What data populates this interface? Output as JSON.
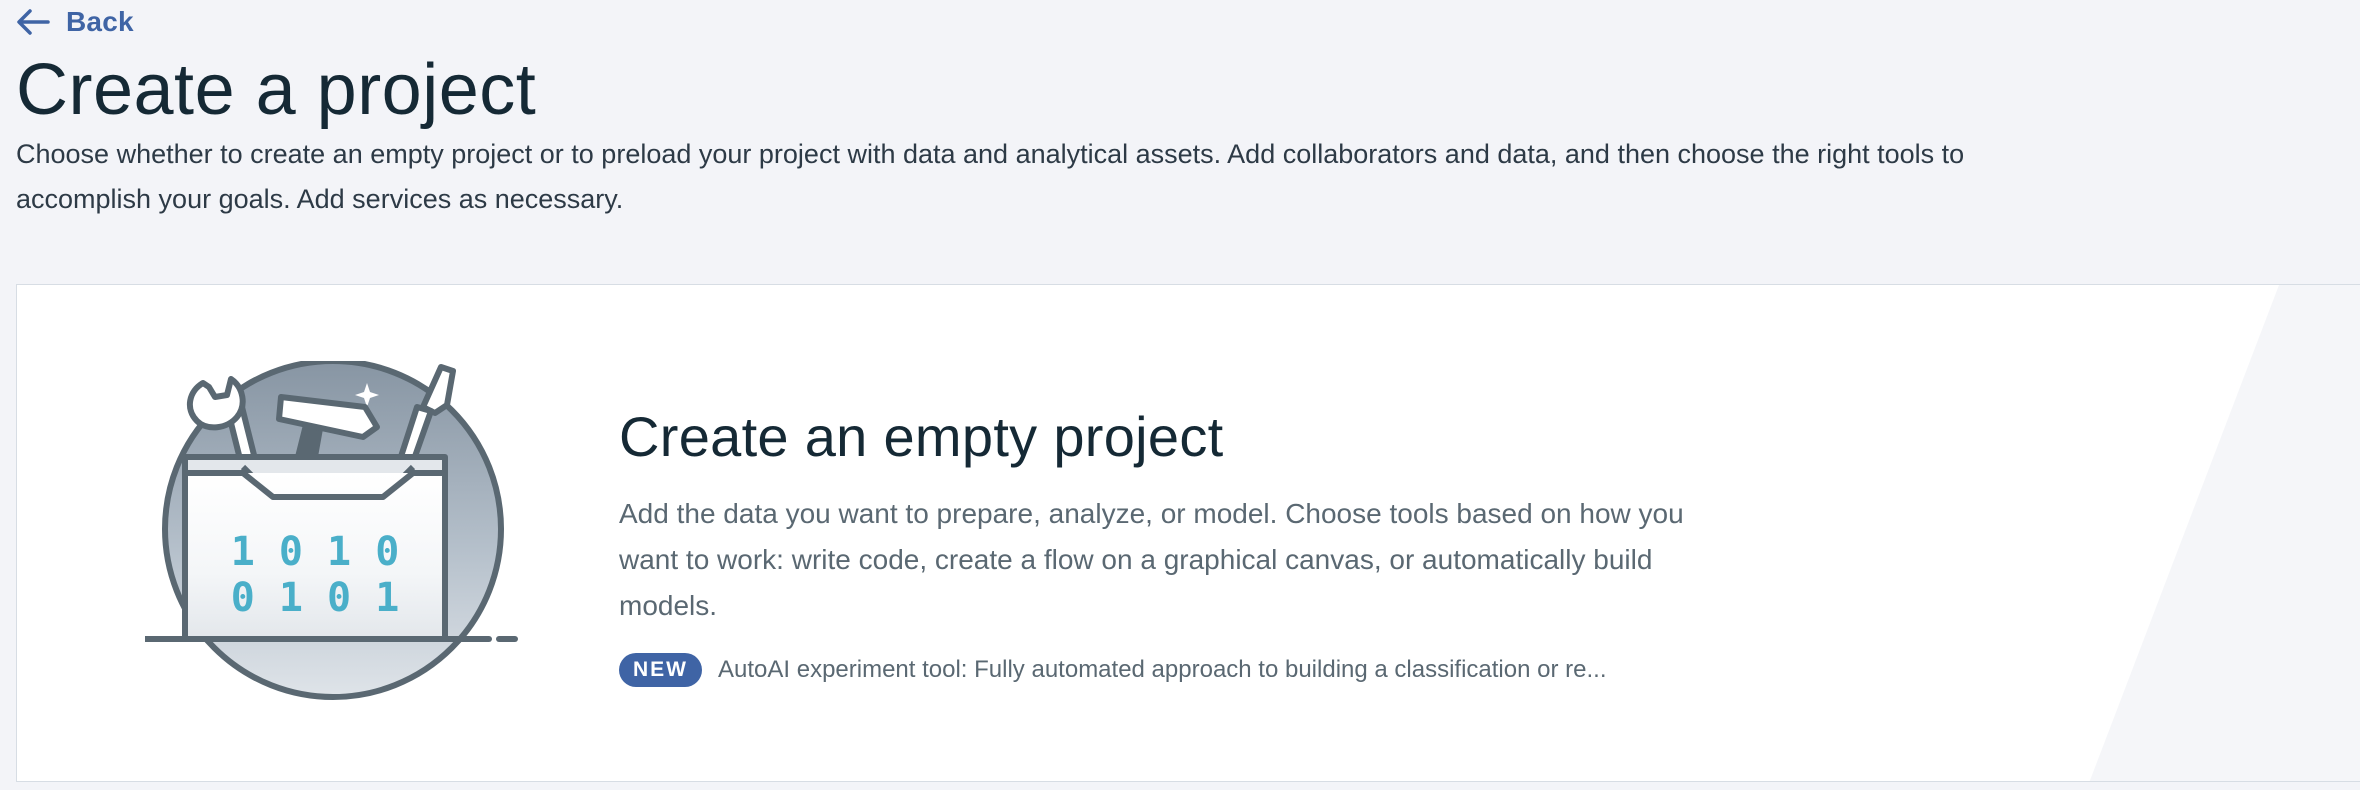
{
  "nav": {
    "back_label": "Back"
  },
  "header": {
    "title": "Create a project",
    "description": "Choose whether to create an empty project or to preload your project with data and analytical assets. Add collaborators and data, and then choose the right tools to accomplish your goals. Add services as necessary."
  },
  "card": {
    "title": "Create an empty project",
    "description": "Add the data you want to prepare, analyze, or model. Choose tools based on how you want to work: write code, create a flow on a graphical canvas, or automatically build models.",
    "badge": "NEW",
    "new_feature_text": "AutoAI experiment tool: Fully automated approach to building a classification or re...",
    "illustration": {
      "icon": "toolbox-icon",
      "binary_line_1": "1 0 1 0",
      "binary_line_2": "0 1 0 1"
    }
  },
  "colors": {
    "page_background": "#f3f4f8",
    "link_blue": "#3f64a5",
    "badge_blue": "#3f64a5",
    "binary_teal": "#4aafc9",
    "illustration_gray": "#5a6872",
    "card_background": "#ffffff"
  }
}
